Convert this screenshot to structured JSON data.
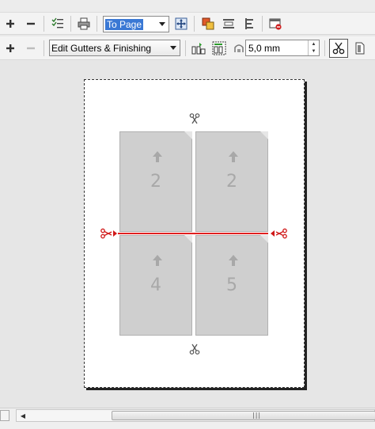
{
  "toolbar_top": {
    "zoom_value": "To Page"
  },
  "toolbar_bottom": {
    "edit_mode_value": "Edit Gutters & Finishing",
    "gutter_value": "5,0 mm"
  },
  "layout": {
    "pages": [
      {
        "number": "2"
      },
      {
        "number": "2"
      },
      {
        "number": "4"
      },
      {
        "number": "5"
      }
    ]
  },
  "colors": {
    "cut_line": "#e02020",
    "page_fill": "#cfcfcf",
    "selection": "#3a78d4"
  },
  "icons": {
    "add": "plus-icon",
    "remove": "minus-icon",
    "checklist": "checklist-icon",
    "print": "printer-icon",
    "fit": "fit-page-icon",
    "scissors": "scissors-icon"
  }
}
